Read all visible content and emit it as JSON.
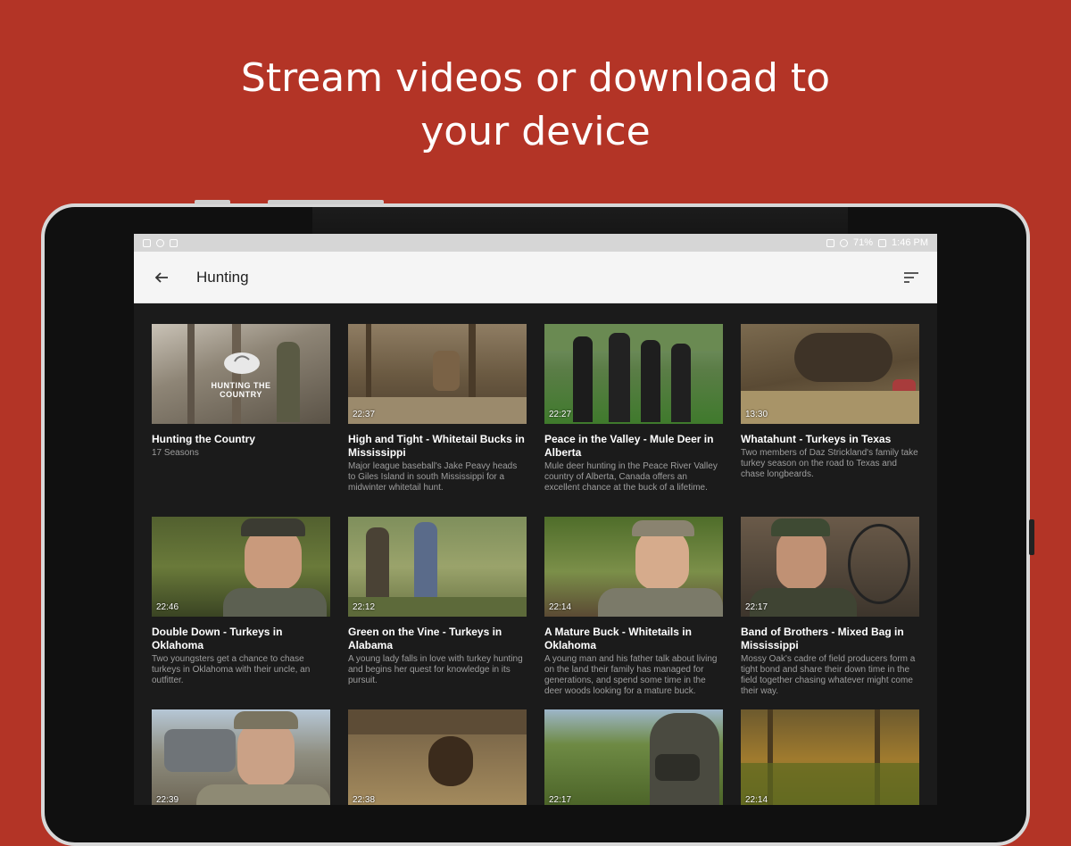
{
  "headline": {
    "line1": "Stream videos or download to",
    "line2": "your device"
  },
  "statusbar": {
    "battery": "71%",
    "time": "1:46 PM"
  },
  "appbar": {
    "title": "Hunting",
    "back_icon": "arrow-back-icon",
    "sort_icon": "sort-icon"
  },
  "cards": [
    {
      "title": "Hunting the Country",
      "desc": "17 Seasons",
      "duration": "",
      "logo": "HUNTING THE COUNTRY"
    },
    {
      "title": "High and Tight - Whitetail Bucks in Mississippi",
      "desc": "Major league baseball's Jake Peavy heads to Giles Island in south Mississippi for a midwinter whitetail hunt.",
      "duration": "22:37"
    },
    {
      "title": "Peace in the Valley - Mule Deer in Alberta",
      "desc": "Mule deer hunting in the Peace River Valley country of Alberta, Canada offers an excellent chance at the buck of a lifetime.",
      "duration": "22:27"
    },
    {
      "title": "Whatahunt - Turkeys in Texas",
      "desc": "Two members of Daz Strickland's family take turkey season on the road to Texas and chase longbeards.",
      "duration": "13:30"
    },
    {
      "title": "Double Down - Turkeys in Oklahoma",
      "desc": "Two youngsters get a chance to chase turkeys in Oklahoma with their uncle, an outfitter.",
      "duration": "22:46"
    },
    {
      "title": "Green on the Vine - Turkeys in Alabama",
      "desc": "A young lady falls in love with turkey hunting and begins her quest for knowledge in its pursuit.",
      "duration": "22:12"
    },
    {
      "title": "A Mature Buck - Whitetails in Oklahoma",
      "desc": "A young man and his father talk about living on the land their family has managed for generations, and spend some time in the deer woods looking for a mature buck.",
      "duration": "22:14"
    },
    {
      "title": "Band of Brothers - Mixed Bag in Mississippi",
      "desc": "Mossy Oak's cadre of field producers form a tight bond and share their down time in the field together chasing whatever might come their way.",
      "duration": "22:17"
    },
    {
      "title": "",
      "desc": "",
      "duration": "22:39"
    },
    {
      "title": "",
      "desc": "",
      "duration": "22:38"
    },
    {
      "title": "",
      "desc": "",
      "duration": "22:17"
    },
    {
      "title": "",
      "desc": "",
      "duration": "22:14"
    }
  ],
  "colors": {
    "background": "#b33426",
    "app_dark": "#1b1b1b",
    "appbar": "#f5f5f5"
  }
}
